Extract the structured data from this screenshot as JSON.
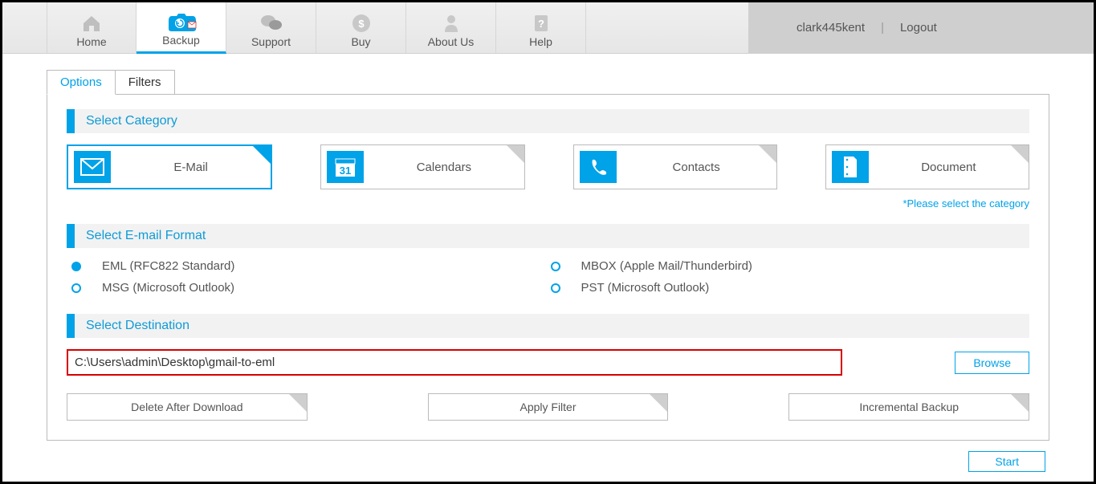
{
  "nav": {
    "home": "Home",
    "backup": "Backup",
    "support": "Support",
    "buy": "Buy",
    "about": "About Us",
    "help": "Help"
  },
  "user": {
    "name": "clark445kent",
    "separator": "|",
    "logout": "Logout"
  },
  "tabs": {
    "options": "Options",
    "filters": "Filters"
  },
  "sections": {
    "category": "Select Category",
    "format": "Select E-mail Format",
    "destination": "Select Destination"
  },
  "categories": {
    "email": "E-Mail",
    "calendars": "Calendars",
    "contacts": "Contacts",
    "document": "Document",
    "hint": "*Please select the category"
  },
  "formats": {
    "eml": "EML (RFC822 Standard)",
    "msg": "MSG (Microsoft Outlook)",
    "mbox": "MBOX (Apple Mail/Thunderbird)",
    "pst": "PST (Microsoft Outlook)"
  },
  "destination": {
    "path": "C:\\Users\\admin\\Desktop\\gmail-to-eml",
    "browse": "Browse"
  },
  "options": {
    "delete": "Delete After Download",
    "apply_filter": "Apply Filter",
    "incremental": "Incremental Backup"
  },
  "start": "Start"
}
